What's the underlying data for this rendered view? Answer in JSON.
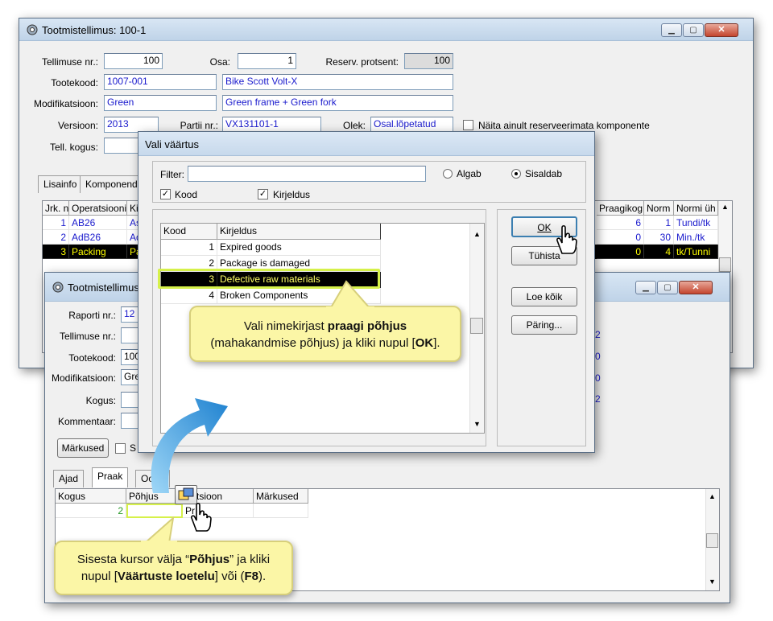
{
  "main_window": {
    "title": "Tootmistellimus: 100-1",
    "fields": {
      "tellimuse_nr_label": "Tellimuse nr.:",
      "tellimuse_nr": "100",
      "osa_label": "Osa:",
      "osa": "1",
      "reserv_label": "Reserv. protsent:",
      "reserv": "100",
      "tootekood_label": "Tootekood:",
      "tootekood": "1007-001",
      "toote_nimi": "Bike Scott Volt-X",
      "modifikatsioon_label": "Modifikatsioon:",
      "modifikatsioon": "Green",
      "modifikatsioon_kirjeldus": "Green frame + Green fork",
      "versioon_label": "Versioon:",
      "versioon": "2013",
      "partii_label": "Partii nr.:",
      "partii": "VX131101-1",
      "olek_label": "Olek:",
      "olek": "Osal.lõpetatud",
      "naita_label": "Näita ainult reserveerimata komponente",
      "tell_kogus_label": "Tell. kogus:"
    },
    "tabs": [
      "Lisainfo",
      "Komponendid"
    ],
    "table": {
      "headers": [
        "Jrk. nr",
        "Operatsiooni",
        "Ki",
        "Praagikog",
        "Norm",
        "Normi üh"
      ],
      "rows": [
        {
          "jrk": "1",
          "op": "AB26",
          "k": "As",
          "praak": "6",
          "norm": "1",
          "uh": "Tundi/tk"
        },
        {
          "jrk": "2",
          "op": "AdB26",
          "k": "Ad",
          "praak": "0",
          "norm": "30",
          "uh": "Min./tk"
        },
        {
          "jrk": "3",
          "op": "Packing",
          "k": "Pa",
          "praak": "0",
          "norm": "4",
          "uh": "tk/Tunni"
        }
      ]
    }
  },
  "report_window": {
    "title": "Tootmistellimus",
    "fields": {
      "raporti_label": "Raporti nr.:",
      "raporti": "12",
      "tellimuse_label": "Tellimuse nr.:",
      "tootekood_label": "Tootekood:",
      "tootekood": "100",
      "modif_label": "Modifikatsioon:",
      "modif": "Gre",
      "kogus_label": "Kogus:",
      "kommentaar_label": "Kommentaar:",
      "markused_btn": "Märkused",
      "s_label": "S"
    },
    "right_vals": [
      "2",
      "0",
      "0",
      "2"
    ],
    "tabs": [
      "Ajad",
      "Praak",
      "Ootel"
    ],
    "table": {
      "headers": [
        "Kogus",
        "Põhjus",
        "Aktsioon",
        "Märkused"
      ],
      "row": {
        "kogus": "2",
        "pohjus": "",
        "aktsioon": "Pr"
      }
    }
  },
  "dialog": {
    "title": "Vali väärtus",
    "filter_label": "Filter:",
    "filter_value": "",
    "radio_algab": "Algab",
    "radio_sisaldab": "Sisaldab",
    "chk_kood": "Kood",
    "chk_kirjeldus": "Kirjeldus",
    "headers": [
      "Kood",
      "Kirjeldus"
    ],
    "rows": [
      {
        "kood": "1",
        "kirjeldus": "Expired goods"
      },
      {
        "kood": "2",
        "kirjeldus": "Package is damaged"
      },
      {
        "kood": "3",
        "kirjeldus": "Defective raw materials"
      },
      {
        "kood": "4",
        "kirjeldus": "Broken Components"
      }
    ],
    "buttons": {
      "ok": "OK",
      "tuhista": "Tühista",
      "loe_koik": "Loe kõik",
      "paring": "Päring..."
    }
  },
  "callouts": {
    "top_pre": "Vali nimekirjast ",
    "top_bold": "praagi põhjus",
    "top_line2a": "(mahakandmise põhjus) ja kliki nupul [",
    "top_bold2": "OK",
    "top_line2b": "].",
    "bottom_pre": "Sisesta kursor välja “",
    "bottom_bold": "Põhjus",
    "bottom_mid": "” ja kliki",
    "bottom_line2a": "nupul [",
    "bottom_bold2": "Väärtuste loetelu",
    "bottom_line2b": "] või (",
    "bottom_bold3": "F8",
    "bottom_line2c": ")."
  },
  "colors": {
    "callout_bg": "#fbf6a6",
    "selected_row_bg": "#000000",
    "selected_row_fg": "#ffff00",
    "highlight": "#d6f14a",
    "arrow": "#2a9ae0"
  }
}
